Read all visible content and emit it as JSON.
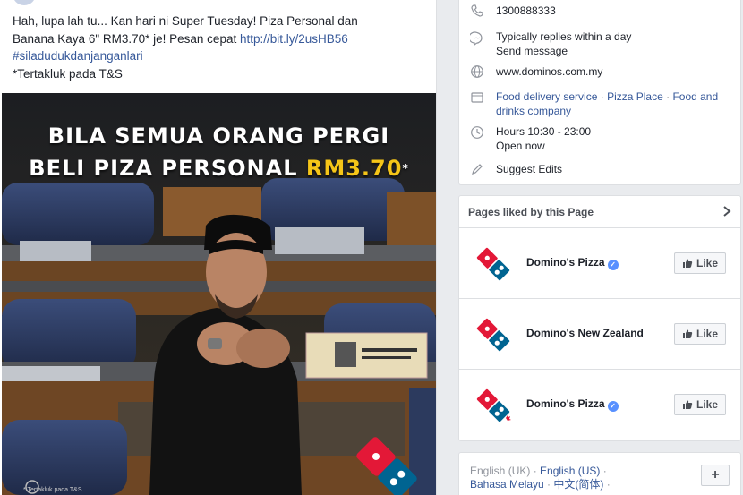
{
  "post": {
    "line1": "Hah, lupa lah tu... Kan hari ni Super Tuesday! Piza Personal dan",
    "line2_text": "Banana Kaya 6\" RM3.70* je! Pesan cepat ",
    "line2_link": "http://bit.ly/2usHB56",
    "hashtag": "#siladudukdanjanganlari",
    "terms": "*Tertakluk pada T&S",
    "image": {
      "headline_line1": "BILA SEMUA ORANG PERGI",
      "headline_line2": "BELI PIZA PERSONAL ",
      "headline_price": "RM3.70",
      "headline_asterisk": "*",
      "footnote": "* Tertakluk pada T&S"
    }
  },
  "info": {
    "phone": "1300888333",
    "messenger_status": "Typically replies within a day",
    "send_message": "Send message",
    "website": "www.dominos.com.my",
    "categories": [
      "Food delivery service",
      "Pizza Place",
      "Food and drinks company"
    ],
    "category_sep": " · ",
    "hours": "Hours 10:30 - 23:00",
    "open_status": "Open now",
    "suggest_edits": "Suggest Edits"
  },
  "liked_pages": {
    "title": "Pages liked by this Page",
    "items": [
      {
        "name": "Domino's Pizza",
        "verified": true,
        "button": "Like"
      },
      {
        "name": "Domino's New Zealand",
        "verified": false,
        "button": "Like"
      },
      {
        "name": "Domino's Pizza",
        "verified": true,
        "button": "Like"
      }
    ]
  },
  "languages": {
    "items": [
      "English (UK)",
      "English (US)",
      "Bahasa Melayu",
      "中文(简体)"
    ],
    "sep": " · ",
    "plus": "+"
  },
  "colors": {
    "link": "#365899",
    "green": "#42b72a",
    "domino_blue": "#006491",
    "domino_red": "#e31837",
    "price_yellow": "#f5c518"
  }
}
